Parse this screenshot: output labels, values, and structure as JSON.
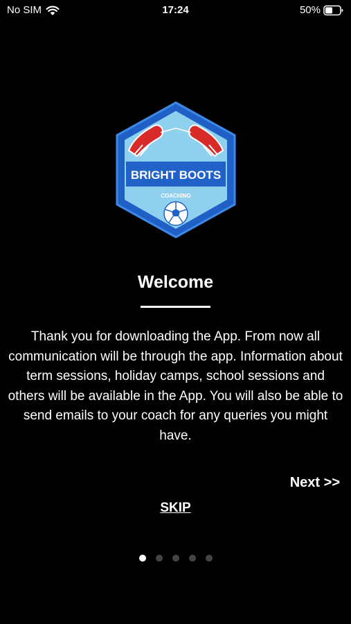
{
  "status_bar": {
    "carrier": "No SIM",
    "time": "17:24",
    "battery": "50%",
    "battery_level": 0.5,
    "wifi_icon": "wifi-icon",
    "battery_icon": "battery-icon"
  },
  "logo": {
    "brand": "BRIGHT BOOTS",
    "subtitle": "COACHING",
    "colors": {
      "outer": "#1f5fc6",
      "inner": "#8fd0ee",
      "banner": "#2162c8",
      "boot": "#d92a2a"
    }
  },
  "welcome": {
    "title": "Welcome",
    "body": "Thank you for downloading the App. From now all communication will be through the app. Information about term sessions, holiday camps, school sessions and others will be available in the App. You will also be able to send emails to your coach for any queries you might have."
  },
  "actions": {
    "next_label": "Next >>",
    "skip_label": "SKIP"
  },
  "pagination": {
    "total": 5,
    "current": 1
  },
  "colors": {
    "background": "#000000",
    "text": "#ffffff",
    "dot_inactive": "#444444"
  }
}
